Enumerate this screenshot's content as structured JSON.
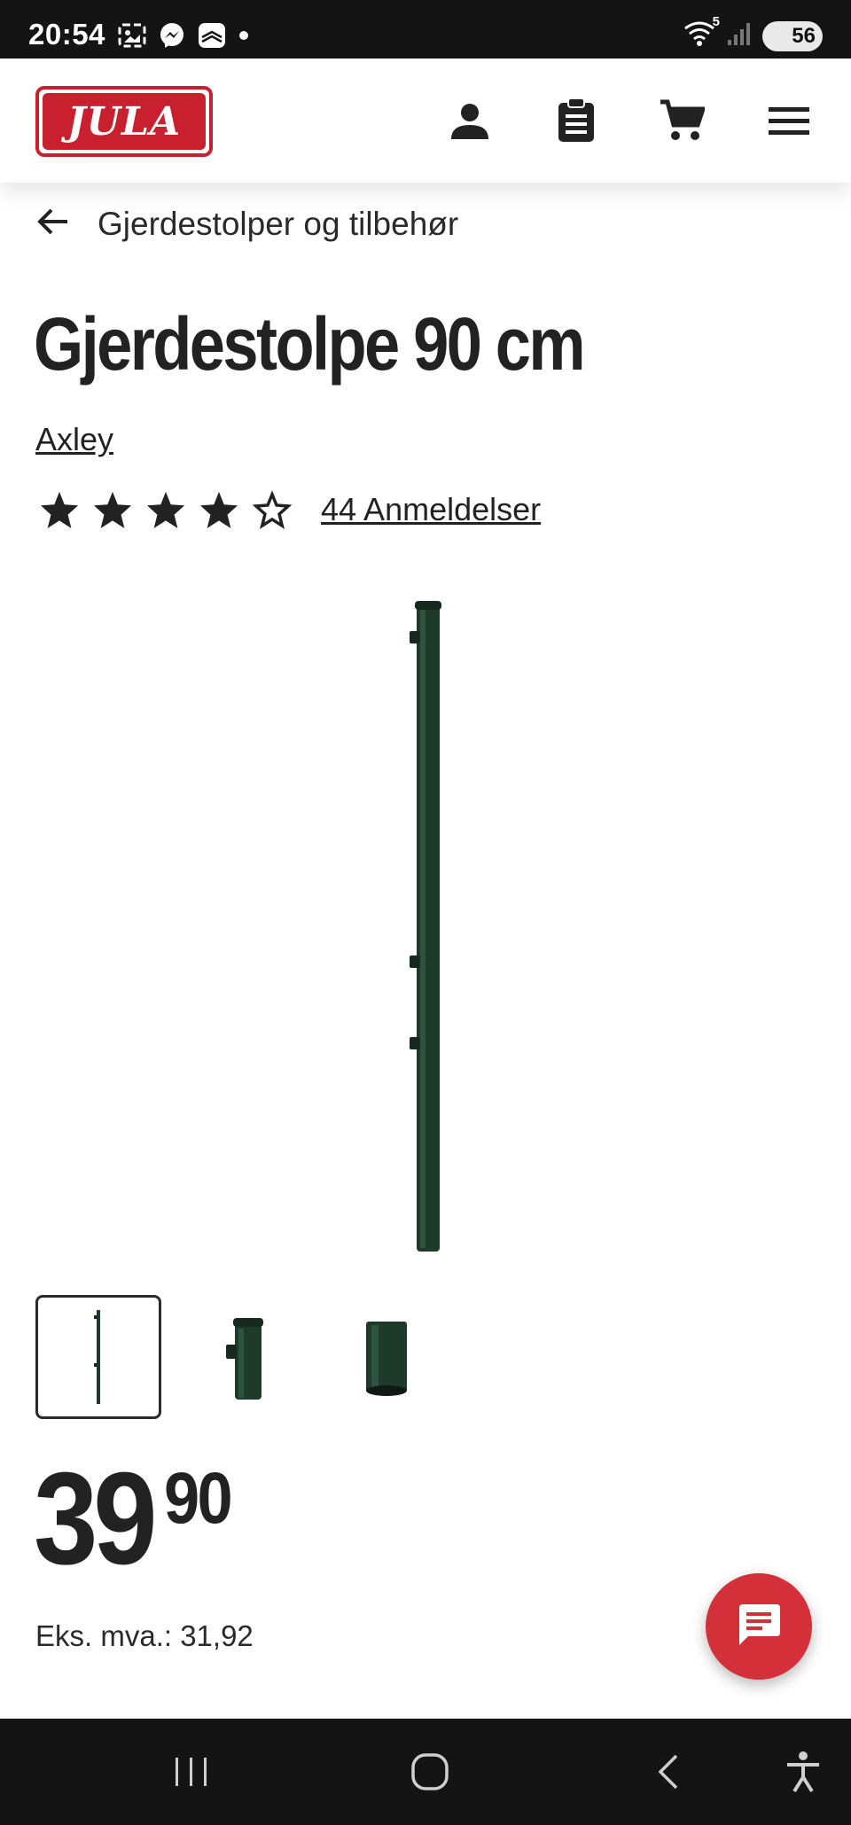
{
  "status_bar": {
    "time": "20:54",
    "battery": "56",
    "wifi_label": "5",
    "icons": [
      "gallery-icon",
      "messenger-icon",
      "app-icon",
      "dot-icon",
      "wifi-icon",
      "signal-icon",
      "battery-icon"
    ]
  },
  "header": {
    "logo_text": "JULA",
    "brand_color": "#c8202f",
    "icons": [
      "account-icon",
      "clipboard-icon",
      "cart-icon",
      "menu-icon"
    ]
  },
  "breadcrumb": {
    "label": "Gjerdestolper og tilbehør"
  },
  "product": {
    "title": "Gjerdestolpe 90 cm",
    "brand": "Axley",
    "rating": 4,
    "rating_max": 5,
    "reviews_label": "44 Anmeldelser",
    "image_color": "#1e3a2a",
    "thumbnails": [
      "full-post",
      "post-top-detail",
      "post-end-detail"
    ],
    "selected_thumbnail": 0
  },
  "price": {
    "main": "39",
    "cents": "90",
    "ex_vat": "Eks. mva.: 31,92"
  },
  "chat": {
    "color": "#d3303a",
    "icon": "chat-icon"
  },
  "nav": {
    "icons": [
      "recents-icon",
      "home-icon",
      "back-icon",
      "accessibility-icon"
    ]
  }
}
